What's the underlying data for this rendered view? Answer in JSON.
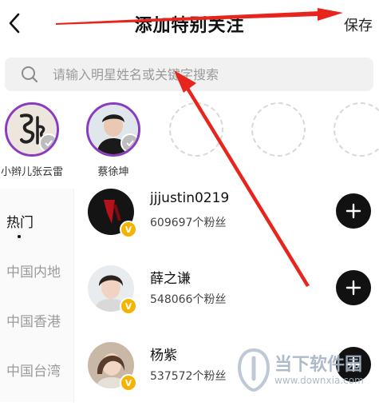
{
  "header": {
    "title": "添加特别关注",
    "save_label": "保存"
  },
  "search": {
    "placeholder": "请输入明星姓名或关键字搜索"
  },
  "selected": [
    {
      "name": "小辫儿张云雷",
      "avatar_icon": "calligraphy-avatar"
    },
    {
      "name": "蔡徐坤",
      "avatar_icon": "portrait-avatar"
    }
  ],
  "categories": {
    "items": [
      "热门",
      "中国内地",
      "中国香港",
      "中国台湾"
    ],
    "active": "热门"
  },
  "stars": [
    {
      "name": "jjjustin0219",
      "fans": "609697个粉丝",
      "verified": true
    },
    {
      "name": "薛之谦",
      "fans": "548066个粉丝",
      "verified": true
    },
    {
      "name": "杨紫",
      "fans": "537572个粉丝",
      "verified": true
    }
  ],
  "watermark": {
    "text": "当下软件园",
    "url": "www.downxia.com"
  },
  "colors": {
    "selected_ring": "#8a3bbf",
    "annotation_arrow": "#e8251c",
    "verified_badge": "#f4b400",
    "add_button": "#111111"
  }
}
